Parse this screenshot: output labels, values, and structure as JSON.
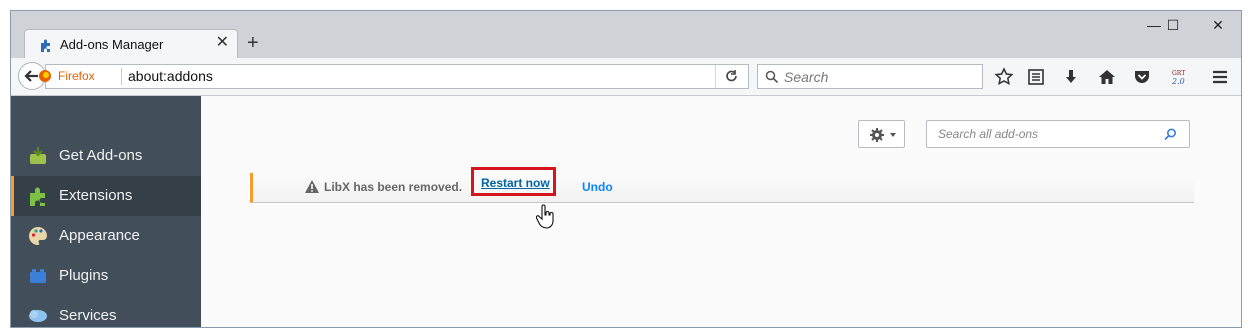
{
  "tab": {
    "title": "Add-ons Manager",
    "close": "✕",
    "new_tab": "+"
  },
  "window_controls": {
    "minimize": "—",
    "maximize": "☐",
    "close": "✕"
  },
  "navbar": {
    "identity_label": "Firefox",
    "url": "about:addons",
    "search_placeholder": "Search"
  },
  "sidebar": {
    "items": [
      {
        "label": "Get Add-ons",
        "icon": "get-addons-icon",
        "selected": false
      },
      {
        "label": "Extensions",
        "icon": "puzzle-icon",
        "selected": true
      },
      {
        "label": "Appearance",
        "icon": "palette-icon",
        "selected": false
      },
      {
        "label": "Plugins",
        "icon": "plugin-brick-icon",
        "selected": false
      },
      {
        "label": "Services",
        "icon": "services-cloud-icon",
        "selected": false
      }
    ]
  },
  "main": {
    "search_placeholder": "Search all add-ons",
    "notification": {
      "message": "LibX has been removed.",
      "restart_label": "Restart now",
      "undo_label": "Undo"
    }
  },
  "colors": {
    "sidebar_bg": "#424f5a",
    "selected_accent": "#f49d2c",
    "link": "#0066a6",
    "highlight_box": "#d4151b"
  }
}
